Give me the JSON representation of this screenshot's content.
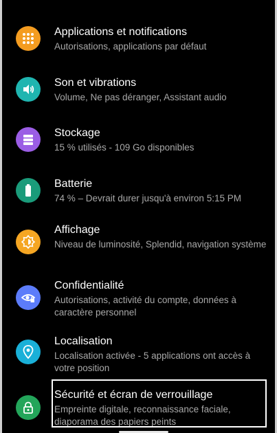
{
  "colors": {
    "apps": "#f49c20",
    "sound": "#1fb5b0",
    "storage": "#9b5de5",
    "battery": "#1a9b7a",
    "display": "#f5a623",
    "privacy": "#5c7cfa",
    "location": "#1ab0d8",
    "security": "#23a55a"
  },
  "items": [
    {
      "title": "Applications et notifications",
      "subtitle": "Autorisations, applications par défaut",
      "icon": "apps-grid-icon"
    },
    {
      "title": "Son et vibrations",
      "subtitle": "Volume, Ne pas déranger, Assistant audio",
      "icon": "speaker-icon"
    },
    {
      "title": "Stockage",
      "subtitle": "15 % utilisés - 109 Go disponibles",
      "icon": "storage-icon"
    },
    {
      "title": "Batterie",
      "subtitle": "74 % – Devrait durer jusqu'à environ 5:15 PM",
      "icon": "battery-icon"
    },
    {
      "title": "Affichage",
      "subtitle": "Niveau de luminosité, Splendid, navigation système",
      "icon": "brightness-icon"
    },
    {
      "title": "Confidentialité",
      "subtitle": "Autorisations, activité du compte, données à caractère personnel",
      "icon": "privacy-eye-icon"
    },
    {
      "title": "Localisation",
      "subtitle": "Localisation activée - 5 applications ont accès à votre position",
      "icon": "location-pin-icon"
    },
    {
      "title": "Sécurité et écran de verrouillage",
      "subtitle": "Empreinte digitale, reconnaissance faciale, diaporama des papiers peints",
      "icon": "lock-icon"
    }
  ]
}
